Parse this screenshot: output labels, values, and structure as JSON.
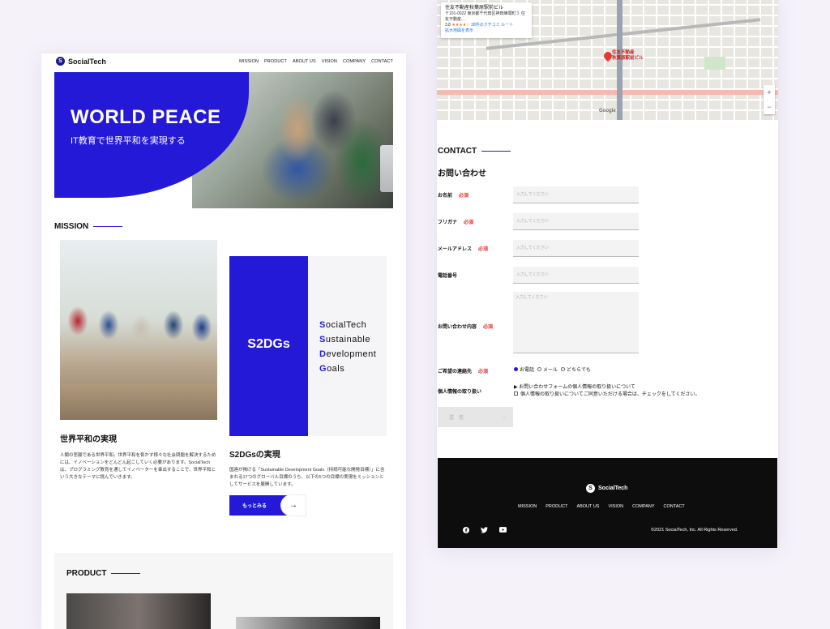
{
  "brand": {
    "name": "SocialTech",
    "logo_glyph": "S"
  },
  "nav": [
    "MISSION",
    "PRODUCT",
    "ABOUT US",
    "VISION",
    "COMPANY",
    "CONTACT"
  ],
  "hero": {
    "title": "WORLD PEACE",
    "subtitle": "IT教育で世界平和を実現する"
  },
  "mission": {
    "heading": "MISSION",
    "card_label": "S2DGs",
    "words": [
      {
        "initial": "S",
        "rest": "ocialTech"
      },
      {
        "initial": "S",
        "rest": "ustainable"
      },
      {
        "initial": "D",
        "rest": "evelopment"
      },
      {
        "initial": "G",
        "rest": "oals"
      }
    ],
    "left_title": "世界平和の実現",
    "left_text": "人類の悲願である世界平和。世界平和を脅かす様々な社会問題を解決するためには、イノベーションをどんどん起こしていく必要があります。SocialTechは、プログラミング教育を通してイノベーターを輩出することで、世界平和という大きなテーマに挑んでいきます。",
    "right_title": "S2DGsの実現",
    "right_text": "国連が掲げる「Sustainable Development Goals（持続可能な開発目標）」に含まれる17つのグローバル目標のうち、以下の5つの目標の実現をミッションとしてサービスを展開しています。",
    "more_label": "もっとみる",
    "more_arrow": "→"
  },
  "product": {
    "heading": "PRODUCT"
  },
  "map": {
    "place_name": "住友不動産秋葉原駅前ビル",
    "address": "〒101-0022 東京都千代田区神田練塀町３ 住友不動産...",
    "rating": "3.8",
    "stars": "★★★★☆",
    "reviews": "38件のクチコミ",
    "route": "ルート",
    "bigger_map": "拡大地図を表示",
    "pin_label": "住友不動産\n秋葉原駅前ビル",
    "zoom_in": "+",
    "zoom_out": "−",
    "google": "Google"
  },
  "contact": {
    "heading": "CONTACT",
    "title": "お問い合わせ",
    "required": "必須",
    "placeholder": "入力してください",
    "fields": [
      {
        "label": "お名前",
        "required": true
      },
      {
        "label": "フリガナ",
        "required": true
      },
      {
        "label": "メールアドレス",
        "required": true
      },
      {
        "label": "電話番号",
        "required": false
      }
    ],
    "inquiry_label": "お問い合わせ内容",
    "preferred_label": "ご希望の連絡先",
    "options": [
      "お電話",
      "メール",
      "どちらでも"
    ],
    "selected_option": "お電話",
    "privacy_label": "個人情報の取り扱い",
    "privacy_line1": "▶ お問い合わせフォームの個人情報の取り扱いについて",
    "privacy_line2": "個人情報の取り扱いについてご同意いただける場合は、チェックをしてください。",
    "submit_label": "送　信",
    "submit_arrow": "→"
  },
  "footer": {
    "nav": [
      "MISSION",
      "PRODUCT",
      "ABOUT US",
      "VISION",
      "COMPANY",
      "CONTACT"
    ],
    "social": [
      "facebook-icon",
      "twitter-icon",
      "youtube-icon"
    ],
    "copyright": "©2021 SocialTech, Inc. All Rights Reserved."
  },
  "colors": {
    "accent": "#2519d8",
    "required": "#e53935",
    "footer_bg": "#0d0d0d",
    "page_bg": "#f6f2fa"
  }
}
